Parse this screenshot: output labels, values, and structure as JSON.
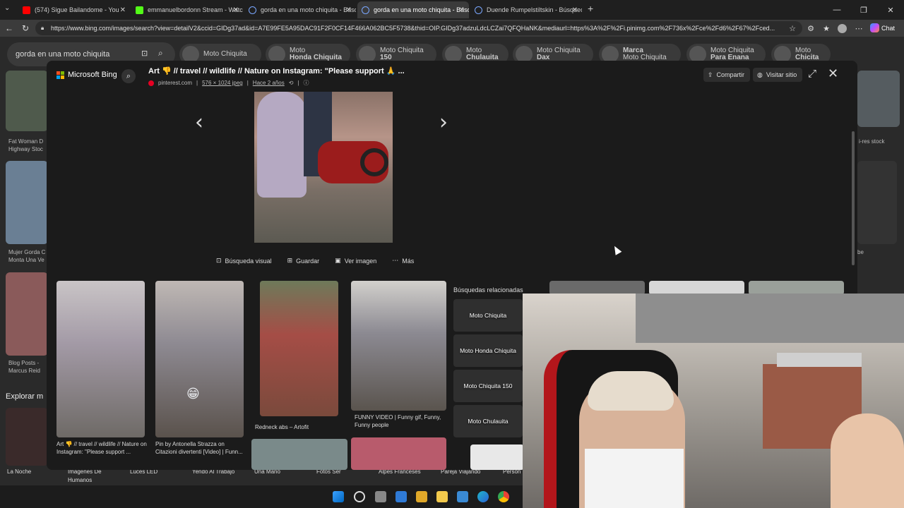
{
  "tabs": [
    {
      "label": "(574) Sigue Bailandome - You",
      "color": "#ff0000"
    },
    {
      "label": "emmanuelbordonn Stream - Watc",
      "color": "#53fc18"
    },
    {
      "label": "gorda en una moto chiquita - Búsq",
      "color": "#7aa7ff"
    },
    {
      "label": "gorda en una moto chiquita - Búsq",
      "color": "#7aa7ff"
    },
    {
      "label": "Duende Rumpelstiltskin - Búsqued",
      "color": "#7aa7ff"
    }
  ],
  "window": {
    "minimize": "—",
    "maximize": "❐",
    "close": "✕",
    "newtab": "+"
  },
  "url": "https://www.bing.com/images/search?view=detailV2&ccid=GIDg37ad&id=A7E99FE5A95DAC91F2F0CF14F466A062BC5F5738&thid=OIP.GIDg37adzuLdcLCZai7QFQHaNK&mediaurl=https%3A%2F%2Fi.pinimg.com%2F736x%2Fce%2Fd6%2F67%2Fced...",
  "chat_label": "Chat",
  "search": {
    "query": "gorda en una moto chiquita"
  },
  "chips": [
    {
      "line1": "Moto Chiquita",
      "line2": ""
    },
    {
      "line1": "Moto",
      "line2": "Honda Chiquita"
    },
    {
      "line1": "Moto Chiquita",
      "line2": "150"
    },
    {
      "line1": "Moto",
      "line2": "Chulauita"
    },
    {
      "line1": "Moto Chiquita",
      "line2": "Dax"
    },
    {
      "line1": "Marca",
      "line2": "Moto Chiquita"
    },
    {
      "line1": "Moto Chiquita",
      "line2": "Para Enana"
    },
    {
      "line1": "Moto",
      "line2": "Chicita"
    }
  ],
  "bg_labels": {
    "fat_woman": "Fat Woman D",
    "highway": "Highway Stoc",
    "mujer": "Mujer Gorda C",
    "monta": "Monta Una Ve",
    "blog": "Blog Posts -",
    "marcus": "Marcus Reid",
    "explorar": "Explorar m",
    "hires": "i-res stock",
    "be": "be"
  },
  "bottom_labels": [
    "La Noche",
    "Imágenes De",
    "Humanos",
    "Luces LED",
    "Yendo Al Trabajo",
    "Una Mano",
    "Fotos Ser",
    "Alpes Franceses",
    "Pareja Viajando",
    "Person"
  ],
  "overlay": {
    "brand": "Microsoft Bing",
    "title": "Art 👎 // travel // wildlife // Nature on Instagram: \"Please support 🙏 ...",
    "source": "pinterest.com",
    "dimensions": "576 × 1024 jpeg",
    "age": "Hace 2 años",
    "share_label": "Compartir",
    "visit_label": "Visitar sitio",
    "actions": {
      "visual": "Búsqueda visual",
      "save": "Guardar",
      "view": "Ver imagen",
      "more": "Más"
    },
    "related_searches_title": "Búsquedas relacionadas",
    "related_searches": [
      "Moto Chiquita",
      "Moto Honda Chiquita",
      "Moto Chiquita 150",
      "Moto Chulauita"
    ],
    "related": [
      {
        "caption": "Art 👎 // travel // wildlife // Nature on Instagram: \"Please support ..."
      },
      {
        "caption": "Pin by Antonella Strazza on Citazioni divertenti [Video] | Funn..."
      },
      {
        "caption": "Redneck abs – Artofit"
      },
      {
        "caption": "FUNNY VIDEO | Funny gif, Funny, Funny people"
      }
    ],
    "emoji": "😁"
  }
}
